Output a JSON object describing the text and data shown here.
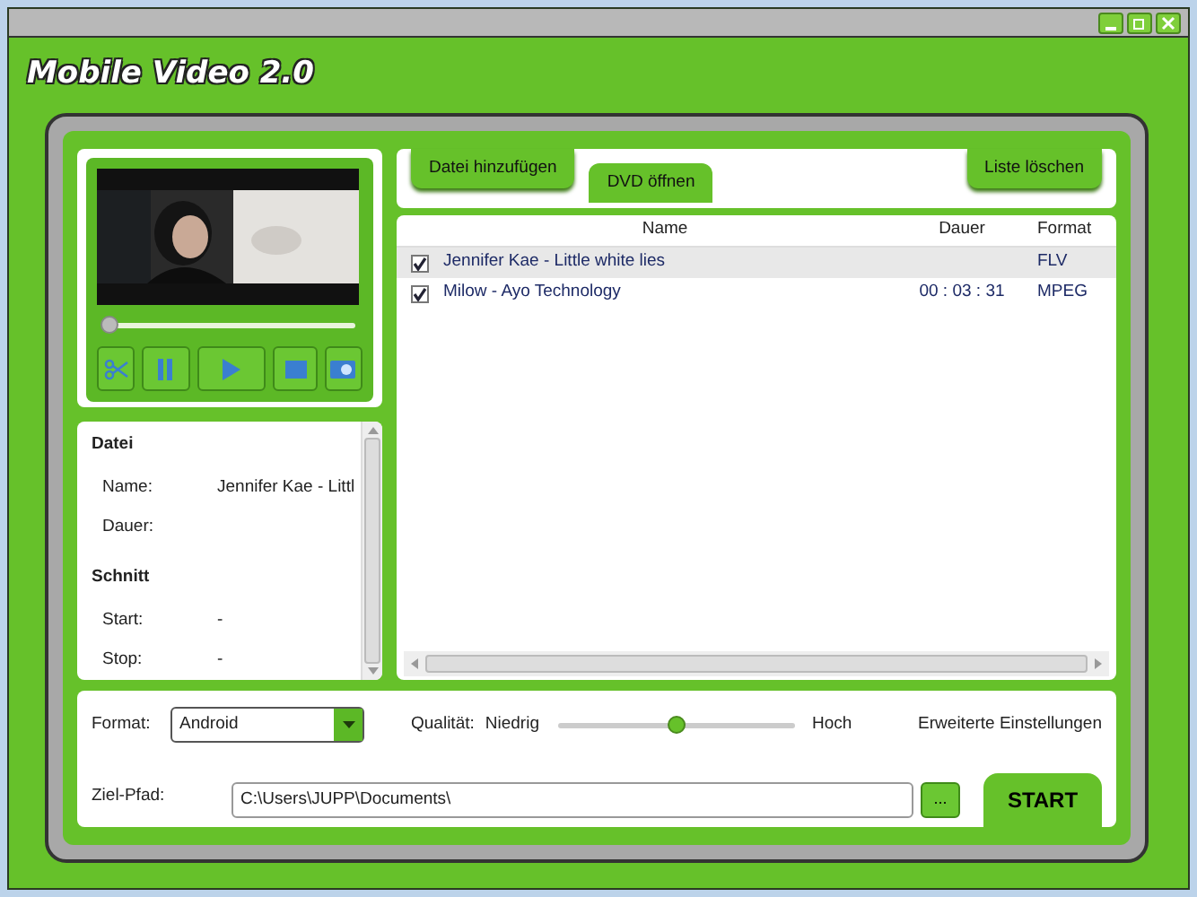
{
  "app": {
    "title": "Mobile Video 2.0"
  },
  "player": {
    "position": {
      "level": 0.02
    }
  },
  "info": {
    "sections": [
      {
        "heading": "Datei",
        "fields": [
          {
            "label": "Name:",
            "value": "Jennifer Kae - Littl"
          },
          {
            "label": "Dauer:"
          }
        ]
      },
      {
        "heading": "Schnitt",
        "fields": [
          {
            "label": "Start:",
            "value": "-"
          },
          {
            "label": "Stop:",
            "value": "-"
          }
        ]
      }
    ]
  },
  "tabs": [
    {
      "label": "Datei hinzufügen",
      "selected": false
    },
    {
      "label": "DVD öffnen",
      "selected": true
    }
  ],
  "clear_button": "Liste löschen",
  "table": {
    "columns": [
      "Name",
      "Dauer",
      "Format"
    ],
    "rows": [
      {
        "checked": true,
        "selected": true,
        "name": "Jennifer Kae - Little white lies",
        "format": "FLV"
      },
      {
        "checked": true,
        "selected": false,
        "name": "Milow - Ayo Technology",
        "duration": "00 : 03 : 31",
        "format": "MPEG"
      }
    ]
  },
  "settings": {
    "format_label": "Format:",
    "format_value": "Android",
    "quality_label": "Qualität:",
    "quality_low": "Niedrig",
    "quality_high": "Hoch",
    "quality": {
      "level": 0.5
    },
    "advanced": "Erweiterte Einstellungen",
    "path_label": "Ziel-Pfad:",
    "path_value": "C:\\Users\\JUPP\\Documents\\",
    "browse_button": "...",
    "start_button": "START"
  }
}
